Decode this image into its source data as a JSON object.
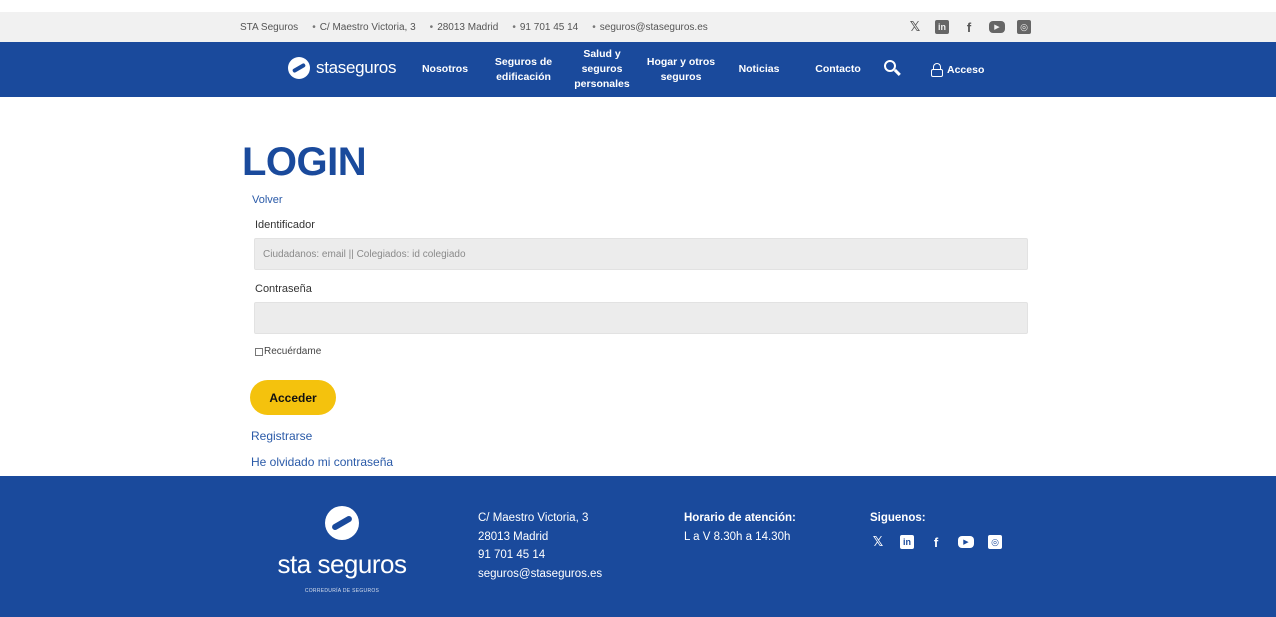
{
  "topbar": {
    "company": "STA Seguros",
    "address": "C/ Maestro Victoria, 3",
    "city": "28013 Madrid",
    "phone": "91 701 45 14",
    "email": "seguros@staseguros.es",
    "social": [
      "x-icon",
      "linkedin-icon",
      "facebook-icon",
      "youtube-icon",
      "instagram-icon"
    ]
  },
  "nav": {
    "brand": "staseguros",
    "items": [
      {
        "label": "Nosotros"
      },
      {
        "label": "Seguros de edificación"
      },
      {
        "label": "Salud y seguros personales"
      },
      {
        "label": "Hogar y otros seguros"
      },
      {
        "label": "Noticias"
      },
      {
        "label": "Contacto"
      }
    ],
    "access": "Acceso"
  },
  "main": {
    "title": "LOGIN",
    "back": "Volver",
    "id_label": "Identificador",
    "id_placeholder": "Ciudadanos: email || Colegiados: id colegiado",
    "pw_label": "Contraseña",
    "remember": "Recuérdame",
    "submit": "Acceder",
    "register": "Registrarse",
    "forgot": "He olvidado mi contraseña"
  },
  "footer": {
    "brand": "sta seguros",
    "brand_sub": "CORREDURÍA DE SEGUROS",
    "address": "C/ Maestro Victoria, 3",
    "city": "28013 Madrid",
    "phone": "91 701 45 14",
    "email": "seguros@staseguros.es",
    "hours_title": "Horario de atención:",
    "hours": "L a V 8.30h a 14.30h",
    "follow_title": "Siguenos:"
  },
  "colors": {
    "brand_blue": "#1a4a9c",
    "button_yellow": "#f4c20d"
  }
}
